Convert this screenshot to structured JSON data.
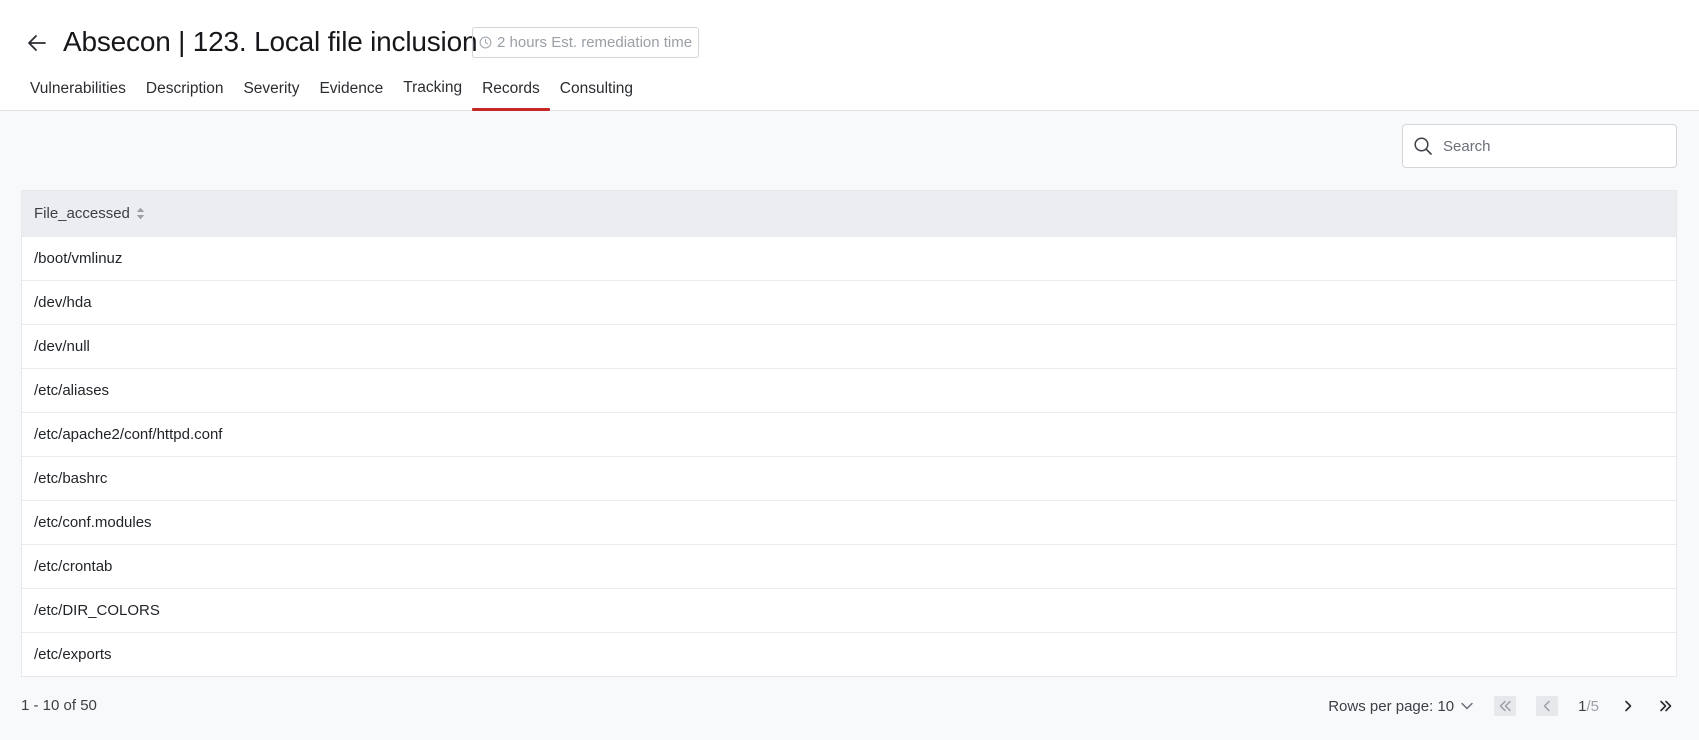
{
  "header": {
    "back_icon": "arrow-left-icon",
    "title": "Absecon | 123. Local file inclusion",
    "remediation": {
      "icon": "clock-icon",
      "text": "2 hours Est. remediation time"
    }
  },
  "tabs": [
    {
      "label": "Vulnerabilities",
      "active": false
    },
    {
      "label": "Description",
      "active": false
    },
    {
      "label": "Severity",
      "active": false
    },
    {
      "label": "Evidence",
      "active": false
    },
    {
      "label": "Tracking",
      "active": false
    },
    {
      "label": "Records",
      "active": true
    },
    {
      "label": "Consulting",
      "active": false
    }
  ],
  "search": {
    "icon": "search-icon",
    "placeholder": "Search",
    "value": ""
  },
  "table": {
    "columns": [
      {
        "label": "File_accessed",
        "sort_icon": "sort-icon"
      }
    ],
    "rows": [
      "/boot/vmlinuz",
      "/dev/hda",
      "/dev/null",
      "/etc/aliases",
      "/etc/apache2/conf/httpd.conf",
      "/etc/bashrc",
      "/etc/conf.modules",
      "/etc/crontab",
      "/etc/DIR_COLORS",
      "/etc/exports"
    ]
  },
  "pagination": {
    "range_text": "1 - 10 of 50",
    "rows_per_page_label": "Rows per page: 10",
    "current_page": "1",
    "separator": "/",
    "total_pages": "5"
  },
  "colors": {
    "accent": "#c62828",
    "header_bg": "#ebedf0"
  }
}
